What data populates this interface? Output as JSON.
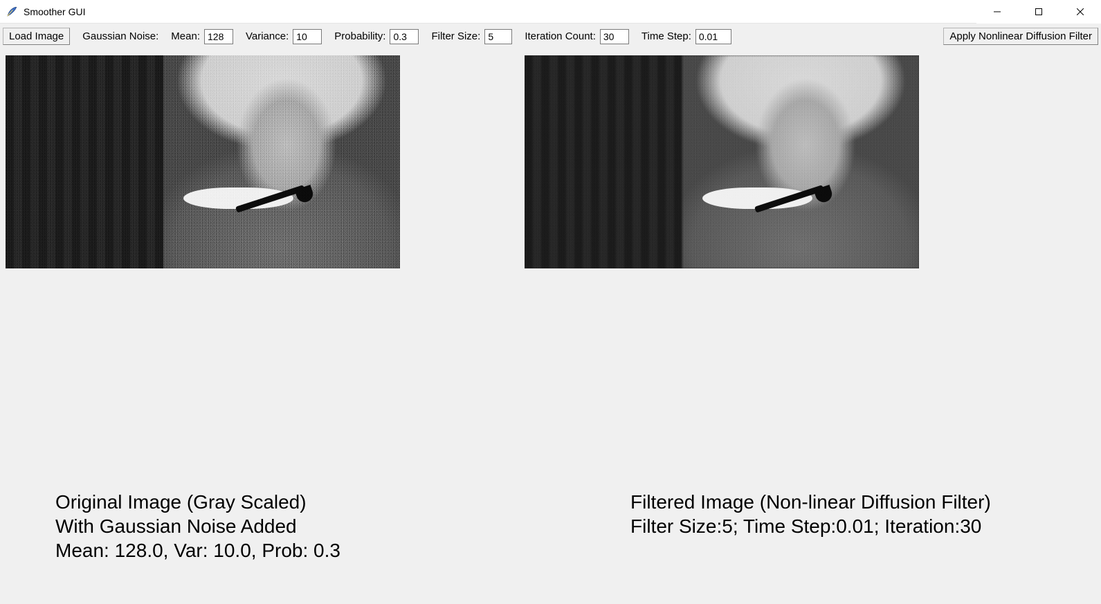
{
  "window": {
    "title": "Smoother GUI"
  },
  "toolbar": {
    "load_button": "Load Image",
    "noise_label": "Gaussian Noise:",
    "apply_button": "Apply Nonlinear Diffusion Filter"
  },
  "params": {
    "mean": {
      "label": "Mean:",
      "value": "128"
    },
    "variance": {
      "label": "Variance:",
      "value": "10"
    },
    "probability": {
      "label": "Probability:",
      "value": "0.3"
    },
    "filter_size": {
      "label": "Filter Size:",
      "value": "5"
    },
    "iteration": {
      "label": "Iteration Count:",
      "value": "30"
    },
    "time_step": {
      "label": "Time Step:",
      "value": "0.01"
    }
  },
  "captions": {
    "left": {
      "line1": "Original Image (Gray Scaled)",
      "line2": "With Gaussian Noise Added",
      "line3": "Mean: 128.0, Var: 10.0, Prob: 0.3"
    },
    "right": {
      "line1": "Filtered Image (Non-linear Diffusion Filter)",
      "line2": "Filter Size:5; Time Step:0.01; Iteration:30"
    }
  }
}
